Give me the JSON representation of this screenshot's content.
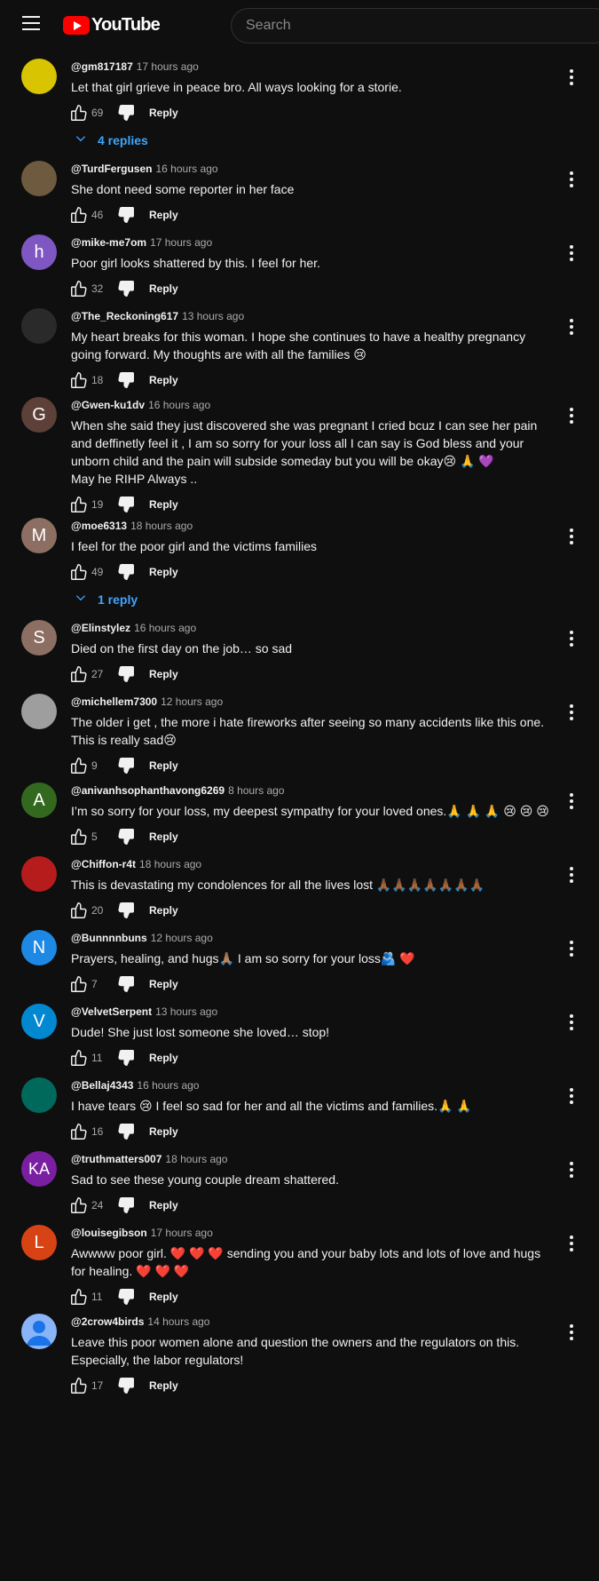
{
  "header": {
    "logo_text": "YouTube",
    "search_placeholder": "Search"
  },
  "comments": [
    {
      "author": "@gm817187",
      "time": "17 hours ago",
      "text": "Let that girl grieve in peace bro. All ways looking for a storie.",
      "likes": "69",
      "reply": "Reply",
      "replies": "4 replies",
      "avatar_letter": "",
      "avatar_color": "#d8c400"
    },
    {
      "author": "@TurdFergusen",
      "time": "16 hours ago",
      "text": "She dont need some reporter in her face",
      "likes": "46",
      "reply": "Reply",
      "avatar_letter": "",
      "avatar_color": "#6d5a3f"
    },
    {
      "author": "@mike-me7om",
      "time": "17 hours ago",
      "text": "Poor girl looks shattered by this. I feel for her.",
      "likes": "32",
      "reply": "Reply",
      "avatar_letter": "h",
      "avatar_color": "#7e57c2"
    },
    {
      "author": "@The_Reckoning617",
      "time": "13 hours ago",
      "text": "My heart breaks for this woman. I hope she continues to have a healthy pregnancy going forward. My thoughts are with all the families 😢",
      "likes": "18",
      "reply": "Reply",
      "avatar_letter": "",
      "avatar_color": "#2a2a2a"
    },
    {
      "author": "@Gwen-ku1dv",
      "time": "16 hours ago",
      "text": "When she said they just discovered she was pregnant I cried bcuz I can see her pain and deffinetly feel it , I am so sorry for your loss all I can say is God bless and your unborn child and the pain will subside someday but you will be okay😢 🙏 💜\nMay he RIHP Always ..",
      "likes": "19",
      "reply": "Reply",
      "avatar_letter": "G",
      "avatar_color": "#5d4037"
    },
    {
      "author": "@moe6313",
      "time": "18 hours ago",
      "text": "I feel for the poor girl and the victims families",
      "likes": "49",
      "reply": "Reply",
      "replies": "1 reply",
      "avatar_letter": "M",
      "avatar_color": "#8d6e63"
    },
    {
      "author": "@Elinstylez",
      "time": "16 hours ago",
      "text": "Died on the first day on the job… so sad",
      "likes": "27",
      "reply": "Reply",
      "avatar_letter": "S",
      "avatar_color": "#8d6e63"
    },
    {
      "author": "@michellem7300",
      "time": "12 hours ago",
      "text": "The older i get , the more i hate fireworks after seeing so many accidents like this one. This is really sad😢",
      "likes": "9",
      "reply": "Reply",
      "avatar_letter": "",
      "avatar_color": "#9e9e9e"
    },
    {
      "author": "@anivanhsophanthavong6269",
      "time": "8 hours ago",
      "text": "I’m so sorry for your loss, my deepest sympathy for your loved ones.🙏 🙏 🙏 😢 😢 😢",
      "likes": "5",
      "reply": "Reply",
      "avatar_letter": "A",
      "avatar_color": "#33691e"
    },
    {
      "author": "@Chiffon-r4t",
      "time": "18 hours ago",
      "text": "This is devastating my condolences for all the lives lost 🙏🏾🙏🏾🙏🏾🙏🏾🙏🏾🙏🏾🙏🏾",
      "likes": "20",
      "reply": "Reply",
      "avatar_letter": "",
      "avatar_color": "#b71c1c"
    },
    {
      "author": "@Bunnnnbuns",
      "time": "12 hours ago",
      "text": "Prayers, healing, and hugs🙏🏽 I am so sorry for your loss🫂 ❤️",
      "likes": "7",
      "reply": "Reply",
      "avatar_letter": "N",
      "avatar_color": "#1e88e5"
    },
    {
      "author": "@VelvetSerpent",
      "time": "13 hours ago",
      "text": "Dude!  She just lost someone she loved… stop!",
      "likes": "11",
      "reply": "Reply",
      "avatar_letter": "V",
      "avatar_color": "#0288d1"
    },
    {
      "author": "@Bellaj4343",
      "time": "16 hours ago",
      "text": "I have tears 😢 I feel so sad for her and all the victims and families.🙏 🙏",
      "likes": "16",
      "reply": "Reply",
      "avatar_letter": "",
      "avatar_color": "#00695c"
    },
    {
      "author": "@truthmatters007",
      "time": "18 hours ago",
      "text": "Sad to see these young couple dream shattered.",
      "likes": "24",
      "reply": "Reply",
      "avatar_letter": "KA",
      "avatar_color": "#7b1fa2"
    },
    {
      "author": "@louisegibson",
      "time": "17 hours ago",
      "text": "Awwww poor girl. ❤️ ❤️ ❤️  sending you and your baby lots and lots of love and hugs for healing. ❤️ ❤️ ❤️",
      "likes": "11",
      "reply": "Reply",
      "avatar_letter": "L",
      "avatar_color": "#d84315"
    },
    {
      "author": "@2crow4birds",
      "time": "14 hours ago",
      "text": "Leave this poor women alone and question the owners and the regulators on this. Especially, the labor regulators!",
      "likes": "17",
      "reply": "Reply",
      "avatar_letter": "",
      "avatar_color": "#8ab4f8"
    }
  ]
}
